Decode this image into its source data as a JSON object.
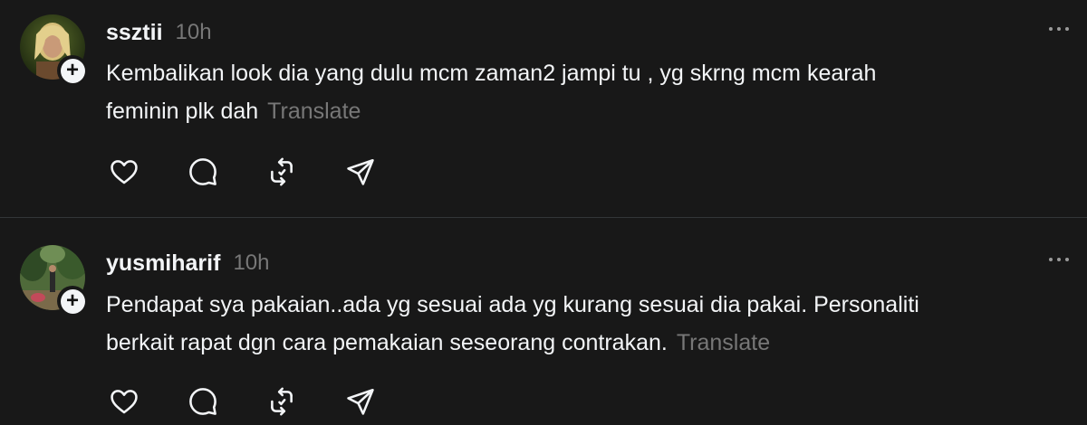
{
  "colors": {
    "background": "#181818",
    "primary_text": "#f3f5f7",
    "secondary_text": "#777777",
    "divider": "#333638"
  },
  "posts": [
    {
      "username": "ssztii",
      "timestamp": "10h",
      "text_line_1": "Kembalikan look dia yang dulu mcm zaman2 jampi tu , yg skrng mcm kearah",
      "text_line_2": "feminin plk dah",
      "translate_label": "Translate",
      "icons": [
        "more-icon",
        "follow-plus-icon",
        "heart-icon",
        "comment-icon",
        "repost-icon",
        "share-icon"
      ]
    },
    {
      "username": "yusmiharif",
      "timestamp": "10h",
      "text_line_1": "Pendapat sya pakaian..ada yg sesuai ada yg kurang sesuai dia pakai. Personaliti",
      "text_line_2": "berkait rapat dgn cara pemakaian seseorang contrakan.",
      "translate_label": "Translate",
      "icons": [
        "more-icon",
        "follow-plus-icon",
        "heart-icon",
        "comment-icon",
        "repost-icon",
        "share-icon"
      ]
    }
  ]
}
